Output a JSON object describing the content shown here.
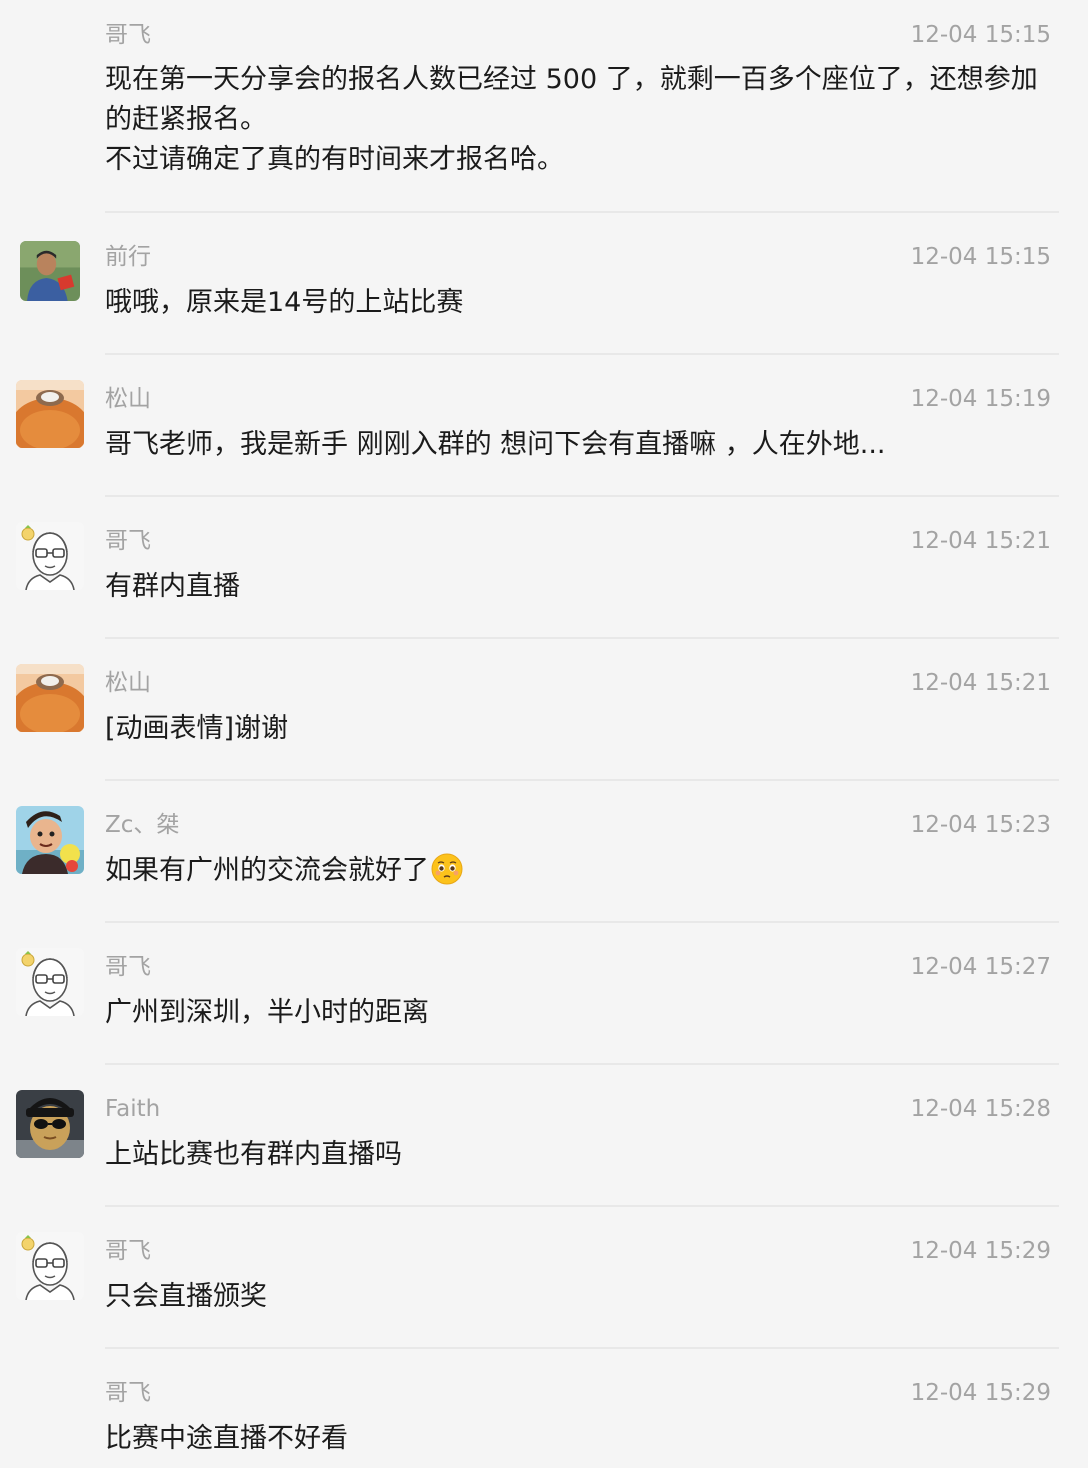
{
  "messages": [
    {
      "sender": "哥飞",
      "time": "12-04 15:15",
      "text": "现在第一天分享会的报名人数已经过 500 了，就剩一百多个座位了，还想参加的赶紧报名。\n不过请确定了真的有时间来才报名哈。",
      "avatar": "none"
    },
    {
      "sender": "前行",
      "time": "12-04 15:15",
      "text": "哦哦，原来是14号的上站比赛",
      "avatar": "person-photo-avatar"
    },
    {
      "sender": "松山",
      "time": "12-04 15:19",
      "text": "哥飞老师，我是新手 刚刚入群的 想问下会有直播嘛 ，人在外地...",
      "avatar": "bread-avatar"
    },
    {
      "sender": "哥飞",
      "time": "12-04 15:21",
      "text": "有群内直播",
      "avatar": "cartoon-glasses-avatar"
    },
    {
      "sender": "松山",
      "time": "12-04 15:21",
      "text": "[动画表情]谢谢",
      "avatar": "bread-avatar"
    },
    {
      "sender": "Zc、桀",
      "time": "12-04 15:23",
      "text": "如果有广州的交流会就好了",
      "emoji": "pleading-face-emoji",
      "avatar": "cartoon-character-avatar"
    },
    {
      "sender": "哥飞",
      "time": "12-04 15:27",
      "text": "广州到深圳，半小时的距离",
      "avatar": "cartoon-glasses-avatar"
    },
    {
      "sender": "Faith",
      "time": "12-04 15:28",
      "text": "上站比赛也有群内直播吗",
      "avatar": "sunglasses-person-avatar"
    },
    {
      "sender": "哥飞",
      "time": "12-04 15:29",
      "text": "只会直播颁奖",
      "avatar": "cartoon-glasses-avatar"
    },
    {
      "sender": "哥飞",
      "time": "12-04 15:29",
      "text": "比赛中途直播不好看",
      "avatar": "none"
    }
  ],
  "colors": {
    "background": "#f5f5f5",
    "meta_text": "#a3a3a3",
    "body_text": "#1b1b1b",
    "divider": "#e8e8e8"
  }
}
